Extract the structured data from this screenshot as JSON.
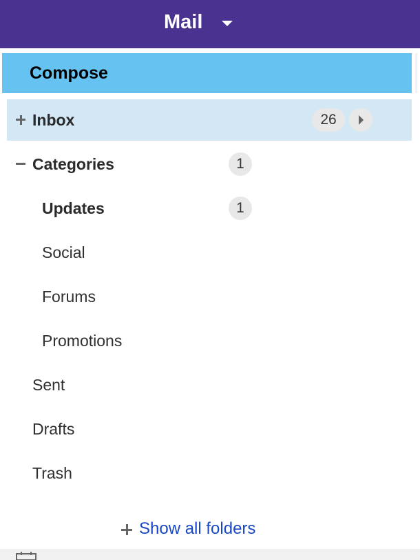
{
  "header": {
    "title": "Mail",
    "dropdown_icon": "caret-down-icon",
    "background_color": "#4a3290"
  },
  "compose": {
    "label": "Compose",
    "background_color": "#66c2f1"
  },
  "folders": {
    "inbox": {
      "label": "Inbox",
      "count": "26",
      "toggle_icon": "plus-icon",
      "expand_icon": "chevron-right-icon",
      "selected": true
    },
    "categories": {
      "label": "Categories",
      "count": "1",
      "toggle_icon": "minus-icon"
    },
    "updates": {
      "label": "Updates",
      "count": "1"
    },
    "social": {
      "label": "Social"
    },
    "forums": {
      "label": "Forums"
    },
    "promotions": {
      "label": "Promotions"
    },
    "sent": {
      "label": "Sent"
    },
    "drafts": {
      "label": "Drafts"
    },
    "trash": {
      "label": "Trash"
    }
  },
  "show_all_folders": {
    "label": "Show all folders",
    "icon": "plus-icon",
    "link_color": "#1a48c4"
  },
  "footer": {
    "icon": "calendar-icon"
  }
}
